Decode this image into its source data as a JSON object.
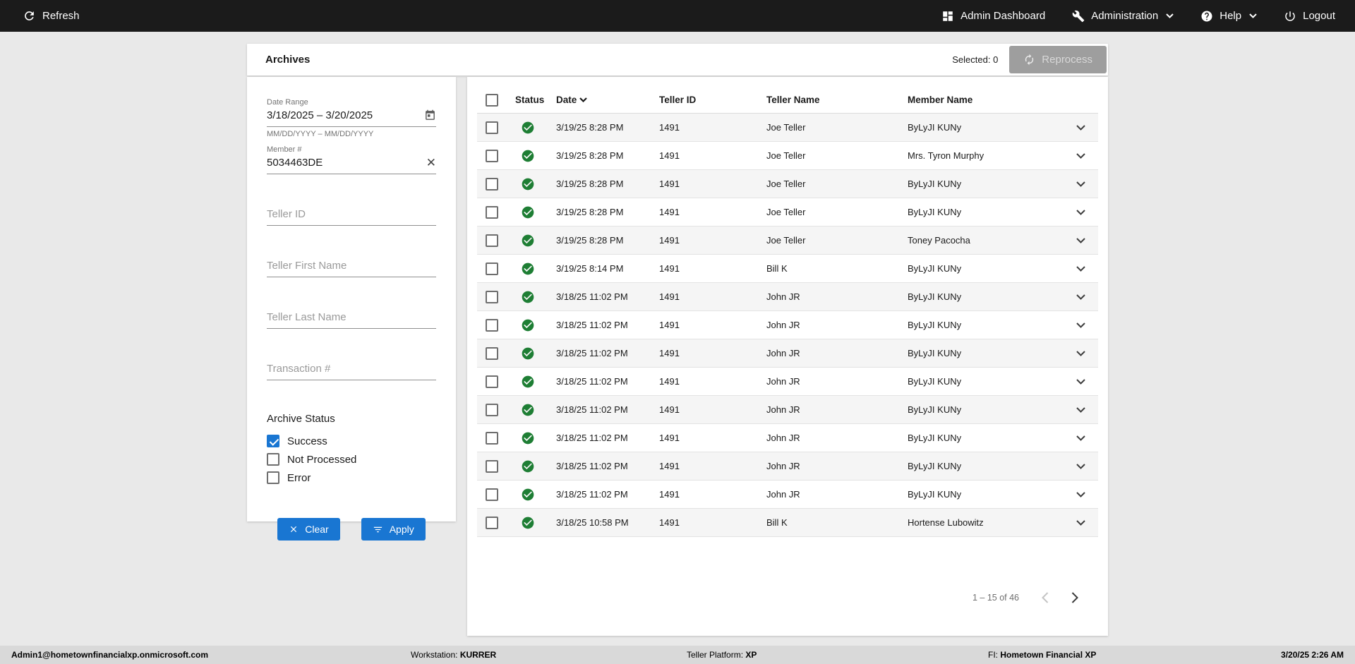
{
  "colors": {
    "topbar_bg": "#1b1b1b",
    "page_bg": "#e9e9e9",
    "card_bg": "#ffffff",
    "accent_blue": "#1976d2",
    "status_green": "#1e7e34",
    "row_alt_bg": "#f5f5f5",
    "footer_bg": "#d9d9d9",
    "disabled_btn_bg": "#9e9e9e"
  },
  "topbar": {
    "refresh": "Refresh",
    "admin_dashboard": "Admin Dashboard",
    "administration": "Administration",
    "help": "Help",
    "logout": "Logout"
  },
  "header": {
    "title": "Archives",
    "selected_label": "Selected: 0",
    "reprocess_label": "Reprocess"
  },
  "filters": {
    "date_range": {
      "label": "Date Range",
      "value": "3/18/2025 – 3/20/2025",
      "helper": "MM/DD/YYYY – MM/DD/YYYY"
    },
    "member": {
      "label": "Member #",
      "value": "5034463DE"
    },
    "teller_id_placeholder": "Teller ID",
    "teller_first_placeholder": "Teller First Name",
    "teller_last_placeholder": "Teller Last Name",
    "transaction_placeholder": "Transaction #",
    "archive_status": {
      "label": "Archive Status",
      "options": [
        {
          "label": "Success",
          "checked": true
        },
        {
          "label": "Not Processed",
          "checked": false
        },
        {
          "label": "Error",
          "checked": false
        }
      ]
    },
    "clear_label": "Clear",
    "apply_label": "Apply"
  },
  "table": {
    "columns": [
      "Status",
      "Date",
      "Teller ID",
      "Teller Name",
      "Member Name"
    ],
    "rows": [
      {
        "date": "3/19/25 8:28 PM",
        "teller_id": "1491",
        "teller_name": "Joe Teller",
        "member_name": "ByLyJI KUNy"
      },
      {
        "date": "3/19/25 8:28 PM",
        "teller_id": "1491",
        "teller_name": "Joe Teller",
        "member_name": "Mrs. Tyron Murphy"
      },
      {
        "date": "3/19/25 8:28 PM",
        "teller_id": "1491",
        "teller_name": "Joe Teller",
        "member_name": "ByLyJI KUNy"
      },
      {
        "date": "3/19/25 8:28 PM",
        "teller_id": "1491",
        "teller_name": "Joe Teller",
        "member_name": "ByLyJI KUNy"
      },
      {
        "date": "3/19/25 8:28 PM",
        "teller_id": "1491",
        "teller_name": "Joe Teller",
        "member_name": "Toney Pacocha"
      },
      {
        "date": "3/19/25 8:14 PM",
        "teller_id": "1491",
        "teller_name": "Bill K",
        "member_name": "ByLyJI KUNy"
      },
      {
        "date": "3/18/25 11:02 PM",
        "teller_id": "1491",
        "teller_name": "John JR",
        "member_name": "ByLyJI KUNy"
      },
      {
        "date": "3/18/25 11:02 PM",
        "teller_id": "1491",
        "teller_name": "John JR",
        "member_name": "ByLyJI KUNy"
      },
      {
        "date": "3/18/25 11:02 PM",
        "teller_id": "1491",
        "teller_name": "John JR",
        "member_name": "ByLyJI KUNy"
      },
      {
        "date": "3/18/25 11:02 PM",
        "teller_id": "1491",
        "teller_name": "John JR",
        "member_name": "ByLyJI KUNy"
      },
      {
        "date": "3/18/25 11:02 PM",
        "teller_id": "1491",
        "teller_name": "John JR",
        "member_name": "ByLyJI KUNy"
      },
      {
        "date": "3/18/25 11:02 PM",
        "teller_id": "1491",
        "teller_name": "John JR",
        "member_name": "ByLyJI KUNy"
      },
      {
        "date": "3/18/25 11:02 PM",
        "teller_id": "1491",
        "teller_name": "John JR",
        "member_name": "ByLyJI KUNy"
      },
      {
        "date": "3/18/25 11:02 PM",
        "teller_id": "1491",
        "teller_name": "John JR",
        "member_name": "ByLyJI KUNy"
      },
      {
        "date": "3/18/25 10:58 PM",
        "teller_id": "1491",
        "teller_name": "Bill K",
        "member_name": "Hortense Lubowitz"
      }
    ],
    "pagination": {
      "label": "1 – 15 of 46"
    }
  },
  "footer": {
    "user": "Admin1@hometownfinancialxp.onmicrosoft.com",
    "workstation_label": "Workstation:",
    "workstation_value": "KURRER",
    "platform_label": "Teller Platform:",
    "platform_value": "XP",
    "fi_label": "FI:",
    "fi_value": "Hometown Financial XP",
    "datetime": "3/20/25 2:26 AM"
  }
}
